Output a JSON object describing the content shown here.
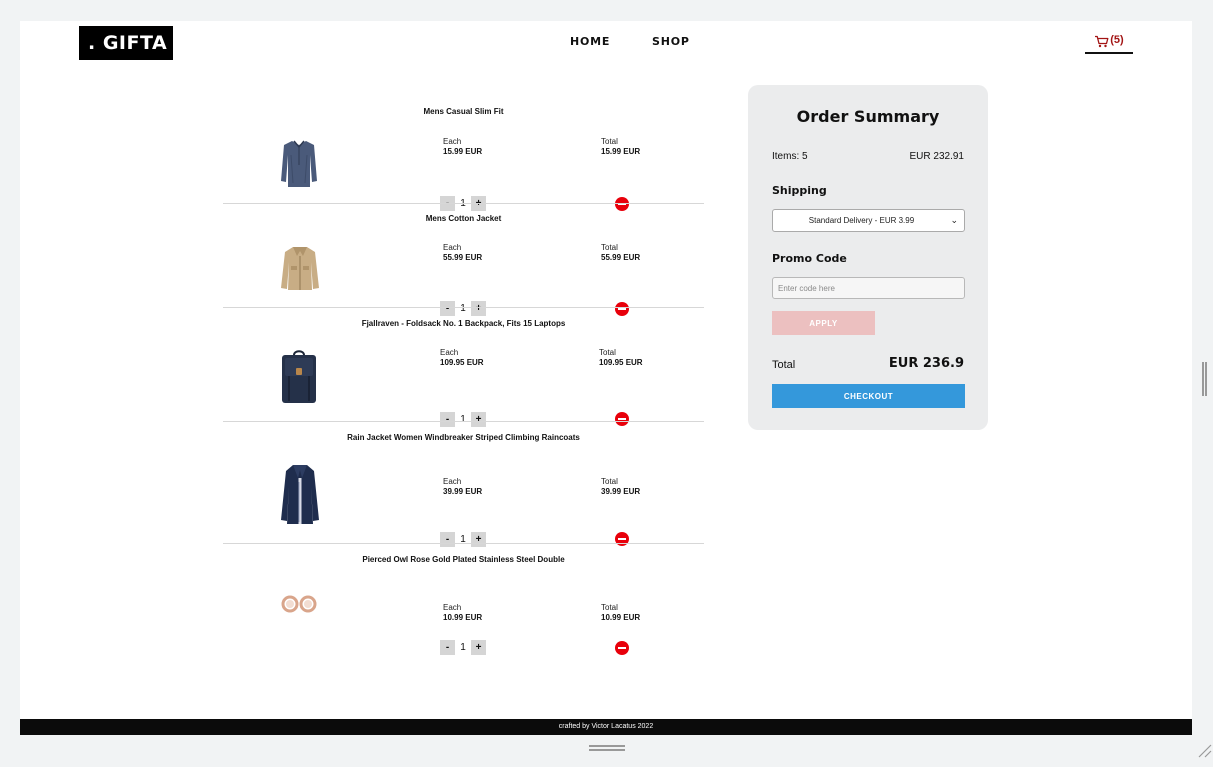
{
  "header": {
    "logo": ". GIFTA",
    "nav": {
      "home": "HOME",
      "shop": "SHOP"
    },
    "cart_count": "(5)",
    "cart_icon": "cart-icon"
  },
  "cart": {
    "each_label": "Each",
    "total_label": "Total",
    "items": [
      {
        "title": "Mens Casual Slim Fit",
        "each": "15.99 EUR",
        "total": "15.99 EUR",
        "qty": "1",
        "image": "shirt"
      },
      {
        "title": "Mens Cotton Jacket",
        "each": "55.99 EUR",
        "total": "55.99 EUR",
        "qty": "1",
        "image": "jacket"
      },
      {
        "title": "Fjallraven - Foldsack No. 1 Backpack, Fits 15 Laptops",
        "each": "109.95 EUR",
        "total": "109.95 EUR",
        "qty": "1",
        "image": "backpack"
      },
      {
        "title": "Rain Jacket Women Windbreaker Striped Climbing Raincoats",
        "each": "39.99 EUR",
        "total": "39.99 EUR",
        "qty": "1",
        "image": "raincoat"
      },
      {
        "title": "Pierced Owl Rose Gold Plated Stainless Steel Double",
        "each": "10.99 EUR",
        "total": "10.99 EUR",
        "qty": "1",
        "image": "earrings"
      }
    ],
    "minus": "-",
    "plus": "+"
  },
  "summary": {
    "title": "Order Summary",
    "items_label": "Items: 5",
    "items_total": "EUR 232.91",
    "shipping_label": "Shipping",
    "shipping_selected": "Standard Delivery - EUR 3.99",
    "promo_label": "Promo Code",
    "promo_placeholder": "Enter code here",
    "apply": "APPLY",
    "total_label": "Total",
    "total_value": "EUR 236.9",
    "checkout": "CHECKOUT"
  },
  "footer": {
    "text": "crafted by Victor Lacatus 2022"
  },
  "colors": {
    "accent": "#3498db",
    "remove": "#e8000b",
    "apply": "#ecc0c0",
    "cart_count": "#a31515"
  }
}
